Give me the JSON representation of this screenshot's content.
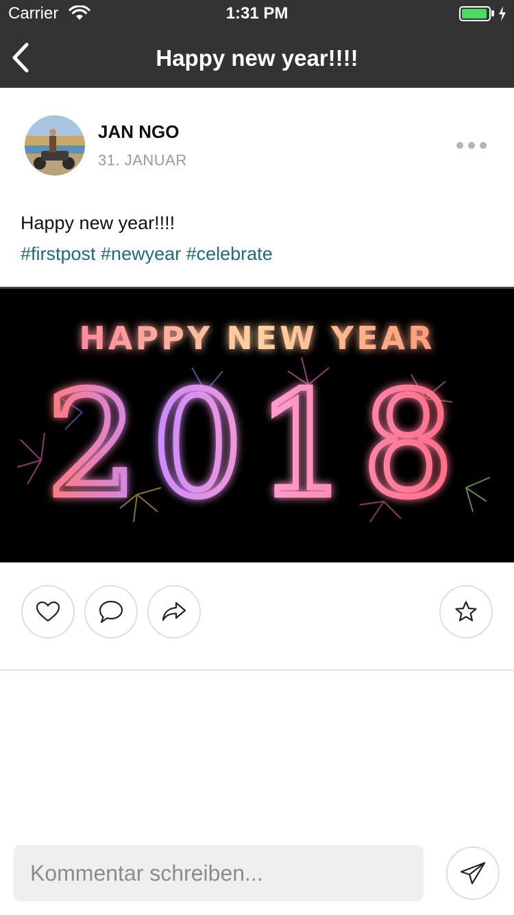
{
  "status_bar": {
    "carrier": "Carrier",
    "time": "1:31 PM",
    "battery_color": "#4cd964"
  },
  "navbar": {
    "title": "Happy new year!!!!",
    "back_icon": "chevron-left-icon",
    "background": "#333333"
  },
  "post": {
    "author": "JAN NGO",
    "date": "31. JANUAR",
    "text": "Happy new year!!!!",
    "hashtags": "#firstpost #newyear #celebrate",
    "hashtag_color": "#1f6b7a",
    "image": {
      "headline": "HAPPY NEW YEAR",
      "year": "2018"
    },
    "menu_icon": "more-horizontal-icon"
  },
  "actions": {
    "like_icon": "heart-icon",
    "comment_icon": "speech-bubble-icon",
    "share_icon": "share-arrow-icon",
    "favorite_icon": "star-icon"
  },
  "comment_bar": {
    "placeholder": "Kommentar schreiben...",
    "send_icon": "paper-plane-icon"
  }
}
